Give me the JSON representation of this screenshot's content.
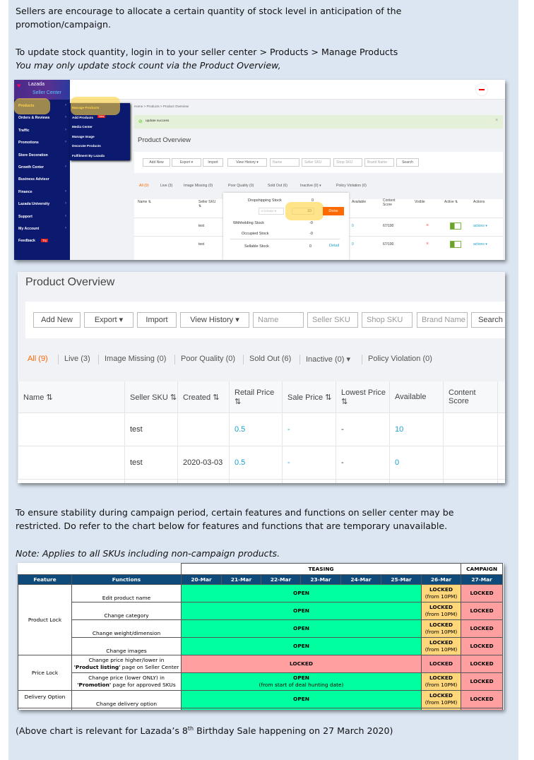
{
  "intro": {
    "p1": "Sellers are encourage to allocate a certain quantity of stock level in anticipation of the",
    "p1b": "promotion/campaign.",
    "p2": "To update stock quantity, login in to your seller center > Products > Manage Products",
    "p3": "You may only update stock count via the Product Overview,"
  },
  "shot1": {
    "logo": "Lazada",
    "logo_sub": "Seller Center",
    "sidebar": [
      "Products",
      "Orders & Reviews",
      "Traffic",
      "Promotions",
      "Store Decoration",
      "Growth Center",
      "Business Advisor",
      "Finance",
      "Lazada University",
      "Support",
      "My Account",
      "Feedback"
    ],
    "feedback_tag": "Try",
    "submenu": [
      "Manage Products",
      "Add Products",
      "Media Center",
      "Manage Image",
      "Decorate Products",
      "Fulfilment By Lazada"
    ],
    "new_tag": "New",
    "breadcrumb": "Home  >  Products  >  Product Overview",
    "alert": "update success",
    "title": "Product Overview",
    "toolbar": [
      "Add New",
      "Export ▾",
      "Import",
      "View History ▾"
    ],
    "filters": [
      "Name",
      "Seller SKU",
      "Shop SKU",
      "Brand Name"
    ],
    "search": "Search",
    "tabs": [
      "All (9)",
      "Live (3)",
      "Image Missing (0)",
      "Poor Quality (0)",
      "Sold Out (6)",
      "Inactive (0) ▾",
      "Policy Violation (0)"
    ],
    "headers": [
      "Name ⇅",
      "Seller SKU ⇅",
      "Available",
      "Content Score",
      "Visible",
      "Active ⇅",
      "Actions"
    ],
    "rows": [
      {
        "sku": "test",
        "available": "0",
        "score": "67/100",
        "actions": "actions ▾"
      },
      {
        "sku": "test",
        "available": "0",
        "score": "67/100",
        "actions": "actions ▾"
      }
    ],
    "popup": {
      "dropshipping": "Dropshipping Stock",
      "dropshipping_val": "0",
      "mode": "Increase ▾",
      "qty": "10",
      "done": "Done",
      "withholding": "Withholding Stock",
      "withholding_val": "-0",
      "occupied": "Occupied Stock",
      "occupied_val": "-0",
      "sellable": "Sellable Stock",
      "sellable_val": "0",
      "detail": "Detail"
    }
  },
  "shot2": {
    "title": "Product Overview",
    "toolbar": [
      "Add New",
      "Export ▾",
      "Import",
      "View History ▾"
    ],
    "filters": [
      "Name",
      "Seller SKU",
      "Shop SKU",
      "Brand Name"
    ],
    "search": "Search",
    "tabs": [
      "All (9)",
      "Live (3)",
      "Image Missing (0)",
      "Poor Quality (0)",
      "Sold Out (6)",
      "Inactive (0) ▾",
      "Policy Violation (0)"
    ],
    "headers": [
      "Name ⇅",
      "Seller SKU ⇅",
      "Created ⇅",
      "Retail Price ⇅",
      "Sale Price ⇅",
      "Lowest Price ⇅",
      "Available",
      "Content Score"
    ],
    "rows": [
      {
        "sku": "test",
        "created": "",
        "retail": "0.5",
        "sale": "-",
        "lowest": "-",
        "available": "10"
      },
      {
        "sku": "test",
        "created": "2020-03-03",
        "retail": "0.5",
        "sale": "-",
        "lowest": "-",
        "available": "0"
      }
    ]
  },
  "mid": {
    "p1": "To ensure stability during campaign period, certain features and functions on seller center may be",
    "p1b": "restricted. Do refer to the chart below for features and functions that are temporary unavailable.",
    "note": "Note: Applies to all SKUs including non-campaign products."
  },
  "schedule": {
    "group_teasing": "TEASING",
    "group_campaign": "CAMPAIGN",
    "headers": [
      "Feature",
      "Functions",
      "20-Mar",
      "21-Mar",
      "22-Mar",
      "23-Mar",
      "24-Mar",
      "25-Mar",
      "26-Mar",
      "27-Mar"
    ],
    "features": [
      "Product Lock",
      "Price Lock",
      "Delivery Option"
    ],
    "functions": [
      "Edit product name",
      "Change category",
      "Change weight/dimension",
      "Change images",
      "Change price higher/lower in",
      "'Product listing'",
      " page on Seller Center",
      "Change price (lower ONLY) in",
      "'Promotion'",
      " page for approved SKUs",
      "Change delivery option"
    ],
    "open": "OPEN",
    "locked": "LOCKED",
    "from10": "(from 10PM)",
    "deal": "(from start of deal hunting date)",
    "colors": {
      "open": "#00ff9e",
      "locked": "#ff9f9f",
      "partial": "#ffd77a",
      "header": "#0e4a7a"
    }
  },
  "footer": {
    "pre": "(Above chart is relevant for Lazada’s 8",
    "sup": "th",
    "post": " Birthday Sale happening on 27 March 2020)"
  }
}
